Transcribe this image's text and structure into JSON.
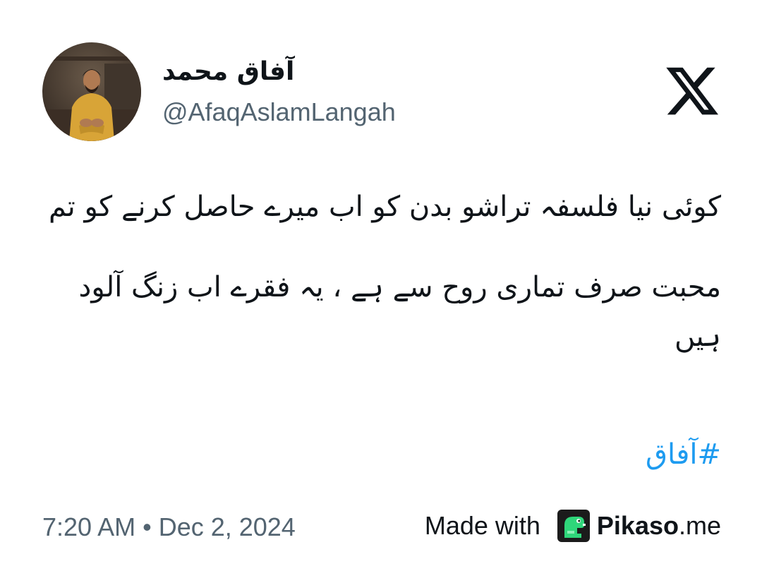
{
  "author": {
    "display_name": "آفاق محمد",
    "handle": "@AfaqAslamLangah",
    "avatar_icon": "profile-photo-icon"
  },
  "platform": {
    "logo_icon": "x-logo-icon"
  },
  "tweet": {
    "paragraphs": [
      "کوئی نیا فلسفہ تراشو بدن کو اب میرے حاصل کرنے کو تم",
      "محبت صرف تماری روح سے ہے ، یہ فقرے اب زنگ آلود ہیں"
    ],
    "hashtag": "#آفاق"
  },
  "footer": {
    "timestamp": "7:20 AM • Dec 2, 2024",
    "made_with_label": "Made with",
    "brand_name": "Pikaso",
    "brand_suffix": ".me",
    "brand_icon": "pikaso-dino-icon"
  },
  "colors": {
    "text_primary": "#0f1419",
    "text_secondary": "#536471",
    "link": "#1d9bf0",
    "background": "#ffffff",
    "pikaso_green": "#2fd67a",
    "pikaso_dark": "#1b1b1b"
  }
}
